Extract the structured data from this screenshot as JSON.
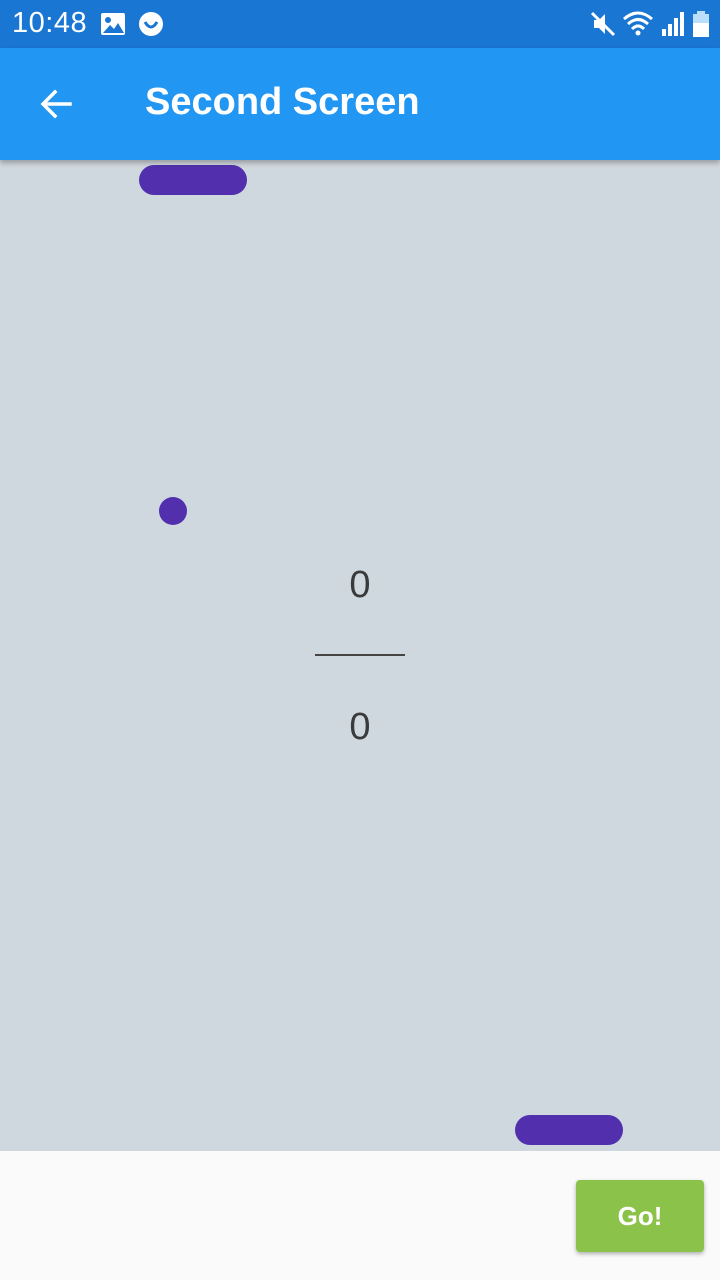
{
  "status_bar": {
    "time": "10:48",
    "icons": [
      "image-icon",
      "smiley-icon",
      "mute-icon",
      "wifi-icon",
      "signal-icon",
      "battery-icon"
    ]
  },
  "app_bar": {
    "title": "Second Screen",
    "back_icon": "arrow-left-icon"
  },
  "game": {
    "score_top": "0",
    "score_bottom": "0"
  },
  "bottom_bar": {
    "go_label": "Go!"
  },
  "colors": {
    "status_bar": "#1976d2",
    "app_bar": "#2196f3",
    "game_background": "#d0d8df",
    "paddle": "#5230ad",
    "ball": "#5230ad",
    "go_button": "#8bc34a"
  }
}
